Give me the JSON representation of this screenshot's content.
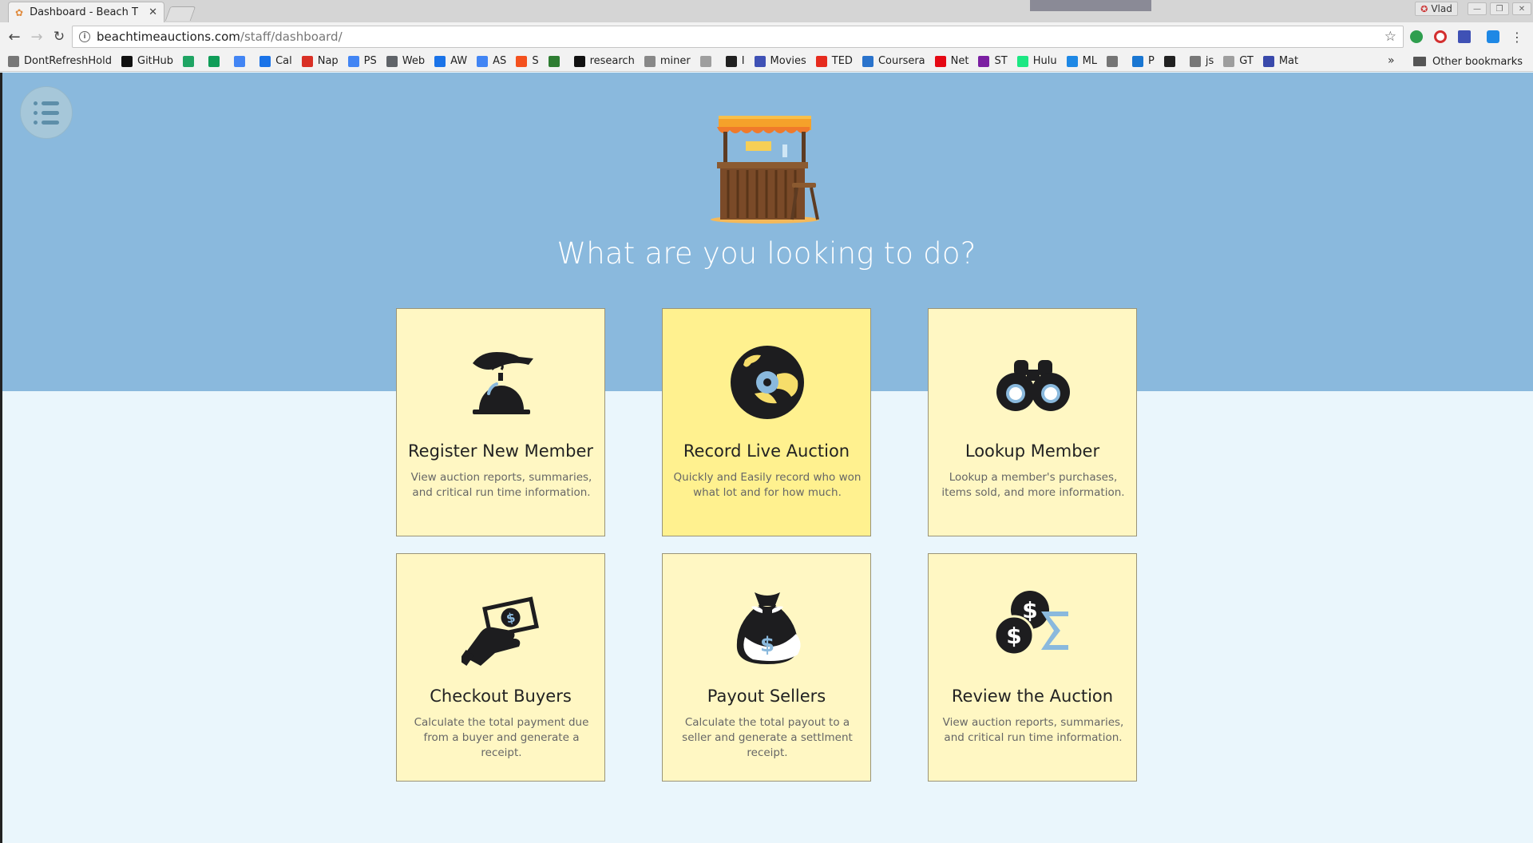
{
  "browser": {
    "tab_title": "Dashboard - Beach T",
    "profile_name": "Vlad",
    "url_host": "beachtimeauctions.com",
    "url_path": "/staff/dashboard/",
    "bookmarks": [
      {
        "label": "DontRefreshHold",
        "icon": "page-icon",
        "color": "#777777"
      },
      {
        "label": "GitHub",
        "icon": "github-icon",
        "color": "#111111"
      },
      {
        "label": "",
        "icon": "drive-icon",
        "color": "#1fa463"
      },
      {
        "label": "",
        "icon": "sheets-icon",
        "color": "#0f9d58"
      },
      {
        "label": "",
        "icon": "docs-icon",
        "color": "#4285f4"
      },
      {
        "label": "Cal",
        "icon": "calendar-icon",
        "color": "#1a73e8"
      },
      {
        "label": "Nap",
        "icon": "gmail-icon",
        "color": "#d93025"
      },
      {
        "label": "PS",
        "icon": "google-icon",
        "color": "#4285f4"
      },
      {
        "label": "Web",
        "icon": "web-icon",
        "color": "#5f6368"
      },
      {
        "label": "AW",
        "icon": "adwords-icon",
        "color": "#1a73e8"
      },
      {
        "label": "AS",
        "icon": "google-icon",
        "color": "#4285f4"
      },
      {
        "label": "S",
        "icon": "s-icon",
        "color": "#f4511e"
      },
      {
        "label": "",
        "icon": "gear-icon",
        "color": "#2e7d32"
      },
      {
        "label": "research",
        "icon": "github-icon",
        "color": "#111111"
      },
      {
        "label": "miner",
        "icon": "pick-icon",
        "color": "#888888"
      },
      {
        "label": "",
        "icon": "globe-icon",
        "color": "#9e9e9e"
      },
      {
        "label": "I",
        "icon": "square-icon",
        "color": "#212121"
      },
      {
        "label": "Movies",
        "icon": "film-icon",
        "color": "#3f51b5"
      },
      {
        "label": "TED",
        "icon": "ted-icon",
        "color": "#e62b1e"
      },
      {
        "label": "Coursera",
        "icon": "infinity-icon",
        "color": "#2a73cc"
      },
      {
        "label": "Net",
        "icon": "netflix-icon",
        "color": "#e50914"
      },
      {
        "label": "ST",
        "icon": "brackets-icon",
        "color": "#7b1fa2"
      },
      {
        "label": "Hulu",
        "icon": "hulu-icon",
        "color": "#1ce783"
      },
      {
        "label": "ML",
        "icon": "k-icon",
        "color": "#1e88e5"
      },
      {
        "label": "",
        "icon": "leaf-icon",
        "color": "#757575"
      },
      {
        "label": "P",
        "icon": "p-icon",
        "color": "#1976d2"
      },
      {
        "label": "",
        "icon": "z-icon",
        "color": "#212121"
      },
      {
        "label": "js",
        "icon": "page-icon",
        "color": "#777777"
      },
      {
        "label": "GT",
        "icon": "line-icon",
        "color": "#9e9e9e"
      },
      {
        "label": "Mat",
        "icon": "shield-icon",
        "color": "#3949ab"
      }
    ],
    "other_bookmarks": "Other bookmarks",
    "overflow": "»"
  },
  "page": {
    "headline": "What are you looking to do?",
    "colors": {
      "hero": "#8ab9dd",
      "body": "#eaf6fc",
      "card": "#fff7c3",
      "card_active": "#fff18f",
      "icon_dark": "#1d1d1f",
      "icon_accent": "#8ab9dd"
    },
    "cards": [
      {
        "title": "Register New Member",
        "desc": "View auction reports, summaries, and critical run time information.",
        "icon": "service-bell-icon"
      },
      {
        "title": "Record Live Auction",
        "desc": "Quickly and Easily record who won what lot and for how much.",
        "icon": "vinyl-record-icon"
      },
      {
        "title": "Lookup Member",
        "desc": "Lookup a member's purchases, items sold, and more information.",
        "icon": "binoculars-icon"
      },
      {
        "title": "Checkout Buyers",
        "desc": "Calculate the total payment due from a buyer and generate a receipt.",
        "icon": "hand-cash-icon"
      },
      {
        "title": "Payout Sellers",
        "desc": "Calculate the total payout to a seller and generate a settlment receipt.",
        "icon": "money-bag-icon"
      },
      {
        "title": "Review the Auction",
        "desc": "View auction reports, summaries, and critical run time information.",
        "icon": "coins-sigma-icon"
      }
    ]
  }
}
